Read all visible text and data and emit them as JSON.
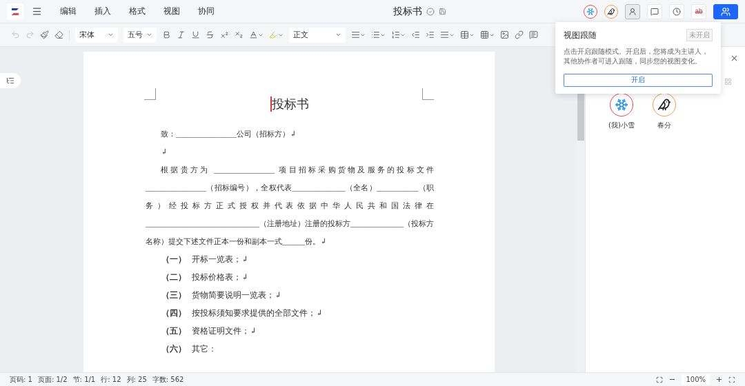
{
  "app": {
    "menu": [
      "编辑",
      "插入",
      "格式",
      "视图",
      "协同"
    ],
    "title": "投标书"
  },
  "collaborators": [
    {
      "kind": "snowflake",
      "color": "#e8474c"
    },
    {
      "kind": "bird",
      "color": "#f0a040"
    }
  ],
  "top_actions": [
    {
      "kind": "follow",
      "selected": true
    },
    {
      "kind": "comment",
      "selected": false
    },
    {
      "kind": "history",
      "selected": false
    },
    {
      "kind": "revision",
      "label": "ab",
      "selected": false
    },
    {
      "kind": "share",
      "selected": false
    }
  ],
  "toolbar": {
    "font": "宋体",
    "size": "五号",
    "style": "正文"
  },
  "popover": {
    "title": "视图跟随",
    "status": "未开启",
    "description": "点击开启跟随模式。开启后，您将成为主讲人，其他协作者可进入跟随，同步您的视图变化。",
    "button": "开启"
  },
  "document": {
    "title": "投标书",
    "paragraphs": [
      {
        "kind": "para",
        "text": "致：________________公司（招标方）↲"
      },
      {
        "kind": "para",
        "text": "↲"
      },
      {
        "kind": "para",
        "text": "根据贵方为 ________________ 项目招标采购货物及服务的投标文件 ________________（招标编号），全权代表______________（全名）___________（职务）经投标方正式授权并代表依据中华人民共和国法律在______________________________（注册地址）注册的投标方______________（投标方名称）提交下述文件正本一份和副本一式______份。↲"
      },
      {
        "kind": "list",
        "marker": "（一）",
        "text": "开标一览表；↲"
      },
      {
        "kind": "list",
        "marker": "（二）",
        "text": "投标价格表；↲"
      },
      {
        "kind": "list",
        "marker": "（三）",
        "text": "货物简要说明一览表；↲"
      },
      {
        "kind": "list",
        "marker": "（四）",
        "text": "按投标须知要求提供的全部文件；↲"
      },
      {
        "kind": "list",
        "marker": "（五）",
        "text": "资格证明文件；↲"
      },
      {
        "kind": "list",
        "marker": "（六）",
        "text": "其它："
      }
    ]
  },
  "members": [
    {
      "name": "(我)小雪",
      "kind": "snowflake",
      "color": "#e8474c"
    },
    {
      "name": "春分",
      "kind": "bird",
      "color": "#f0a040"
    }
  ],
  "status_bar": {
    "items": [
      "页码: 1",
      "页面: 1/2",
      "节: 1/1",
      "行: 12",
      "列: 25",
      "字数: 562"
    ],
    "zoom": "100%"
  }
}
